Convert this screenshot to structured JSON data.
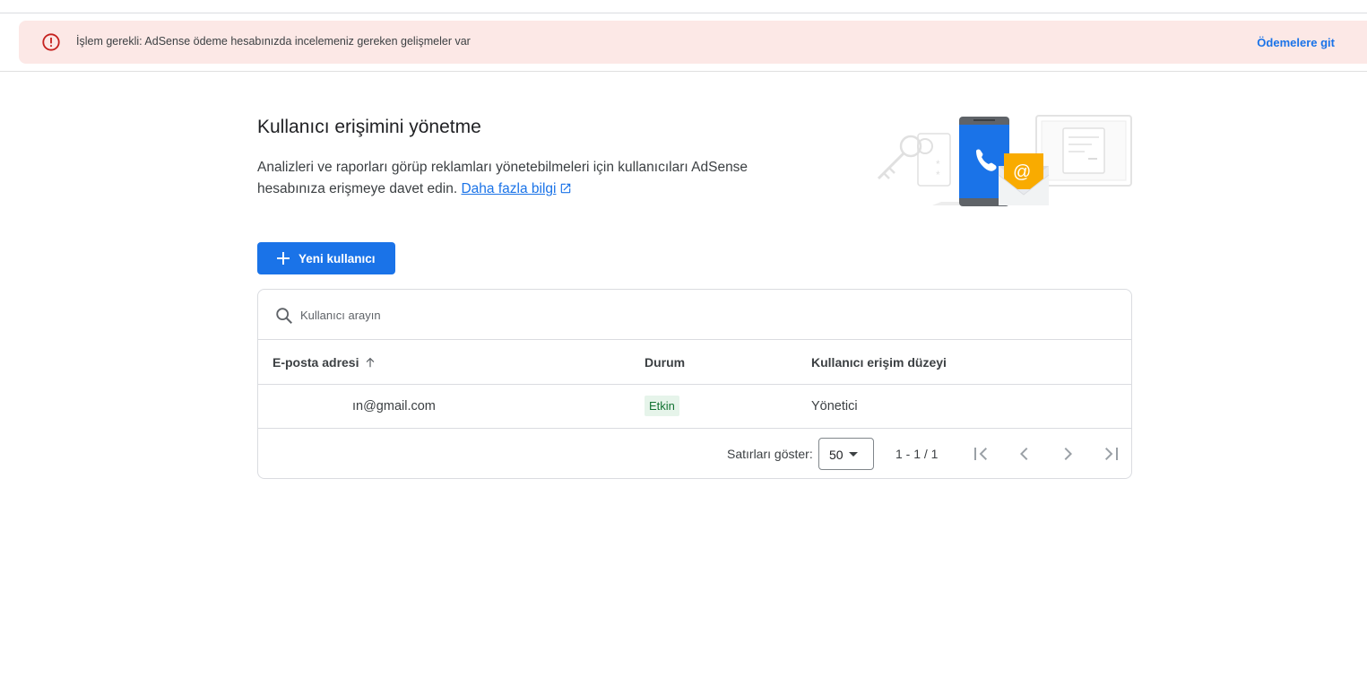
{
  "banner": {
    "icon": "error-icon",
    "message": "İşlem gerekli: AdSense ödeme hesabınızda incelemeniz gereken gelişmeler var",
    "action_label": "Ödemelere git"
  },
  "page": {
    "title": "Kullanıcı erişimini yönetme",
    "description": "Analizleri ve raporları görüp reklamları yönetebilmeleri için kullanıcıları AdSense hesabınıza erişmeye davet edin.",
    "learn_more": "Daha fazla bilgi"
  },
  "new_user_button": {
    "label": "Yeni kullanıcı"
  },
  "search": {
    "placeholder": "Kullanıcı arayın",
    "value": ""
  },
  "table": {
    "columns": [
      "E-posta adresi",
      "Durum",
      "Kullanıcı erişim düzeyi"
    ],
    "rows": [
      {
        "email": "ın@gmail.com",
        "status": "Etkin",
        "access_level": "Yönetici"
      }
    ]
  },
  "pagination": {
    "rows_label": "Satırları göster:",
    "rows_per_page": "50",
    "range": "1 - 1 / 1"
  },
  "colors": {
    "accent": "#1a73e8",
    "banner_bg": "#fce8e6",
    "error": "#c5221f",
    "status_bg": "#e6f4ea",
    "status_text": "#137333"
  }
}
